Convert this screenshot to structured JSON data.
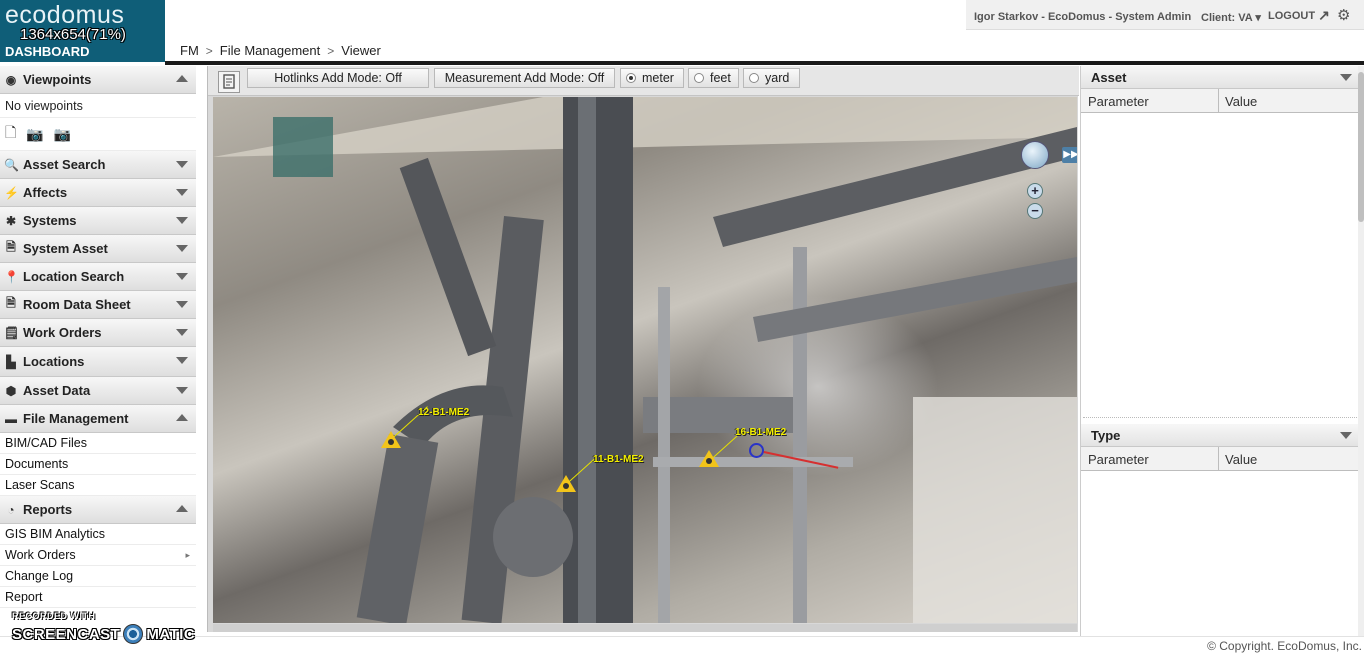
{
  "app": {
    "logo": "ecodomus",
    "resolution_overlay": "1364x654(71%)",
    "dashboard_label": "DASHBOARD"
  },
  "breadcrumb": [
    "FM",
    "File Management",
    "Viewer"
  ],
  "user_bar": {
    "user": "Igor Starkov - EcoDomus - System Admin",
    "client": "Client: VA",
    "logout": "LOGOUT"
  },
  "sidebar": {
    "viewpoints": {
      "label": "Viewpoints",
      "empty_text": "No viewpoints",
      "expanded": true
    },
    "sections": [
      {
        "label": "Asset Search",
        "icon": "search-doc-icon",
        "expanded": false
      },
      {
        "label": "Affects",
        "icon": "lightning-icon",
        "expanded": false
      },
      {
        "label": "Systems",
        "icon": "systems-icon",
        "expanded": false
      },
      {
        "label": "System Asset",
        "icon": "document-icon",
        "expanded": false
      },
      {
        "label": "Location Search",
        "icon": "location-pin-icon",
        "expanded": false
      },
      {
        "label": "Room Data Sheet",
        "icon": "document-icon",
        "expanded": false
      },
      {
        "label": "Work Orders",
        "icon": "work-order-icon",
        "expanded": false
      },
      {
        "label": "Locations",
        "icon": "buildings-icon",
        "expanded": false
      },
      {
        "label": "Asset Data",
        "icon": "cube-icon",
        "expanded": false
      }
    ],
    "file_management": {
      "label": "File Management",
      "items": [
        "BIM/CAD Files",
        "Documents",
        "Laser Scans"
      ]
    },
    "reports": {
      "label": "Reports",
      "items": [
        "GIS BIM Analytics",
        "Work Orders",
        "Change Log",
        "Report"
      ]
    }
  },
  "viewer": {
    "hotlinks_mode": "Hotlinks Add Mode: Off",
    "measurement_mode": "Measurement Add Mode: Off",
    "units": [
      {
        "label": "meter",
        "selected": true
      },
      {
        "label": "feet",
        "selected": false
      },
      {
        "label": "yard",
        "selected": false
      }
    ],
    "hotlinks": [
      "12-B1-ME2",
      "11-B1-ME2",
      "16-B1-ME2"
    ]
  },
  "right_panel": {
    "asset": {
      "title": "Asset",
      "col_parameter": "Parameter",
      "col_value": "Value"
    },
    "type": {
      "title": "Type",
      "col_parameter": "Parameter",
      "col_value": "Value"
    }
  },
  "footer": {
    "copyright": "© Copyright. EcoDomus, Inc.",
    "watermark_top": "RECORDED WITH",
    "watermark_brand_left": "SCREENCAST",
    "watermark_brand_right": "MATIC"
  },
  "colors": {
    "brand": "#0f5e78",
    "hotlink": "#f2c41a",
    "hotlink_label": "#f4f000",
    "measure_circle": "#2a34c8",
    "measure_line": "#d63030"
  }
}
